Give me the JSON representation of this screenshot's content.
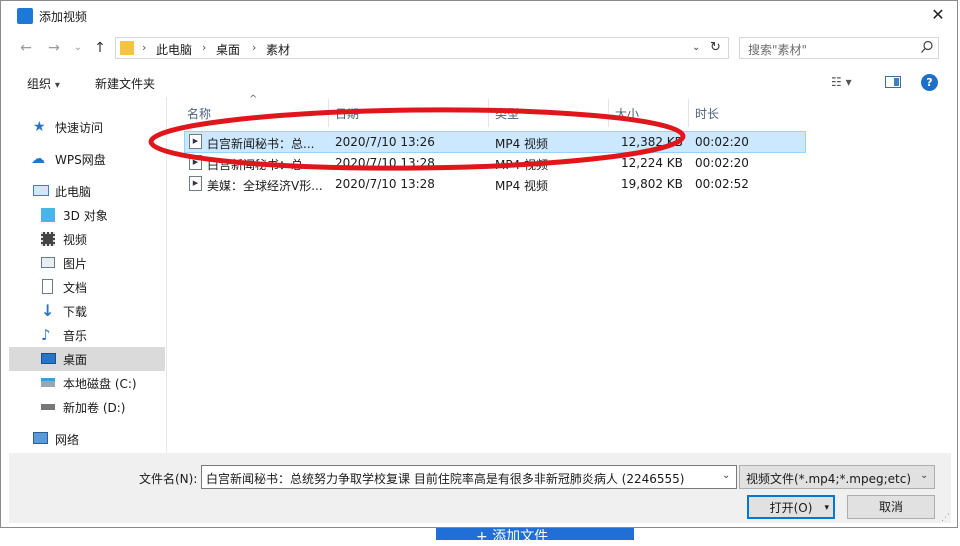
{
  "window": {
    "title": "添加视频"
  },
  "address": {
    "crumbs": [
      "此电脑",
      "桌面",
      "素材"
    ]
  },
  "search": {
    "placeholder": "搜索\"素材\""
  },
  "toolbar": {
    "organize_label": "组织",
    "new_folder_label": "新建文件夹"
  },
  "nav": [
    {
      "label": "快速访问",
      "icon": "star-icon"
    },
    {
      "label": "WPS网盘",
      "icon": "cloud-icon"
    },
    {
      "label": "此电脑",
      "icon": "computer-icon"
    },
    {
      "label": "3D 对象",
      "icon": "cube-icon"
    },
    {
      "label": "视频",
      "icon": "video-folder-icon"
    },
    {
      "label": "图片",
      "icon": "picture-folder-icon"
    },
    {
      "label": "文档",
      "icon": "document-folder-icon"
    },
    {
      "label": "下载",
      "icon": "download-icon"
    },
    {
      "label": "音乐",
      "icon": "music-icon"
    },
    {
      "label": "桌面",
      "icon": "desktop-icon",
      "selected": true
    },
    {
      "label": "本地磁盘 (C:)",
      "icon": "drive-icon"
    },
    {
      "label": "新加卷 (D:)",
      "icon": "drive-icon"
    },
    {
      "label": "网络",
      "icon": "network-icon"
    }
  ],
  "columns": {
    "name": "名称",
    "date": "日期",
    "type": "类型",
    "size": "大小",
    "duration": "时长"
  },
  "files": [
    {
      "name": "白宫新闻秘书：总...",
      "date": "2020/7/10 13:26",
      "type": "MP4 视频",
      "size": "12,382 KB",
      "duration": "00:02:20",
      "selected": true
    },
    {
      "name": "白宫新闻秘书：总...",
      "date": "2020/7/10 13:28",
      "type": "MP4 视频",
      "size": "12,224 KB",
      "duration": "00:02:20"
    },
    {
      "name": "美媒：全球经济V形...",
      "date": "2020/7/10 13:28",
      "type": "MP4 视频",
      "size": "19,802 KB",
      "duration": "00:02:52"
    }
  ],
  "footer": {
    "filename_label": "文件名(N):",
    "filename_value": "白宫新闻秘书：总统努力争取学校复课 目前住院率高是有很多非新冠肺炎病人 (2246555)",
    "filetype_value": "视频文件(*.mp4;*.mpeg;etc)",
    "open_label": "打开(O)",
    "cancel_label": "取消"
  },
  "background": {
    "add_file_label": "+ 添加文件"
  },
  "colors": {
    "accent": "#0078d7",
    "highlight_ring": "#e0161c",
    "selection": "#cce8ff"
  }
}
